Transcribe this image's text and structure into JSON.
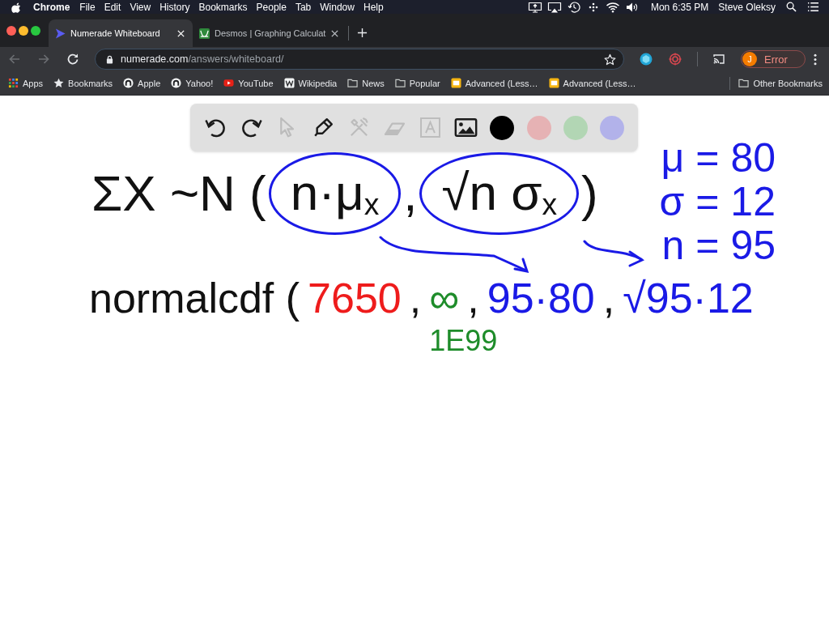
{
  "menu_bar": {
    "app": "Chrome",
    "menus": [
      "File",
      "Edit",
      "View",
      "History",
      "Bookmarks",
      "People",
      "Tab",
      "Window",
      "Help"
    ],
    "clock": "Mon 6:35 PM",
    "user": "Steve Oleksy"
  },
  "tabs": [
    {
      "title": "Numerade Whiteboard",
      "selected": true
    },
    {
      "title": "Desmos | Graphing Calculat",
      "selected": false
    }
  ],
  "toolbar": {
    "back_disabled": true,
    "forward_disabled": true,
    "url_host": "numerade.com",
    "url_path": "/answers/whiteboard/",
    "profile_initial": "J",
    "profile_status": "Error"
  },
  "bookmarks": {
    "items": [
      {
        "label": "Apps",
        "kind": "apps"
      },
      {
        "label": "Bookmarks",
        "kind": "star"
      },
      {
        "label": "Apple",
        "kind": "site"
      },
      {
        "label": "Yahoo!",
        "kind": "site"
      },
      {
        "label": "YouTube",
        "kind": "video"
      },
      {
        "label": "Wikipedia",
        "kind": "tile"
      },
      {
        "label": "News",
        "kind": "folder"
      },
      {
        "label": "Popular",
        "kind": "folder"
      },
      {
        "label": "Advanced (Less…",
        "kind": "doc"
      },
      {
        "label": "Advanced (Less…",
        "kind": "doc"
      }
    ],
    "other": "Other Bookmarks"
  },
  "whiteboard": {
    "toolbar": {
      "tools": [
        {
          "kind": "undo",
          "disabled": false
        },
        {
          "kind": "redo",
          "disabled": false
        },
        {
          "kind": "select",
          "disabled": true
        },
        {
          "kind": "pen",
          "disabled": false
        },
        {
          "kind": "tools",
          "disabled": true
        },
        {
          "kind": "eraser",
          "disabled": true
        },
        {
          "kind": "text",
          "disabled": true
        },
        {
          "kind": "image",
          "disabled": false
        }
      ],
      "colors": [
        {
          "color": "#000000"
        },
        {
          "color": "#e6b2b4"
        },
        {
          "color": "#b2d6b4"
        },
        {
          "color": "#b2b2ea"
        }
      ]
    },
    "expression": [
      {
        "text": "ΣX ~N (",
        "circled": false
      },
      {
        "text": "n·μ$_{x}$",
        "circled": true
      },
      {
        "text": ",",
        "circled": false
      },
      {
        "text": "√n σ$_{x}$",
        "circled": true
      },
      {
        "text": ")",
        "circled": false
      }
    ],
    "givens": [
      "μ = 80",
      "σ = 12",
      "n = 95"
    ],
    "normalcdf": [
      {
        "text": "normalcdf (",
        "color": "#111111"
      },
      {
        "text": "7650",
        "color": "#ee1c1c"
      },
      {
        "text": ",",
        "color": "#111111"
      },
      {
        "text": "∞",
        "color": "#1e8c2a",
        "note": "1E99"
      },
      {
        "text": ",",
        "color": "#111111"
      },
      {
        "text": "95·80",
        "color": "#1a1ae6"
      },
      {
        "text": ",",
        "color": "#111111"
      },
      {
        "text": "√95·12",
        "color": "#1a1ae6"
      }
    ]
  }
}
